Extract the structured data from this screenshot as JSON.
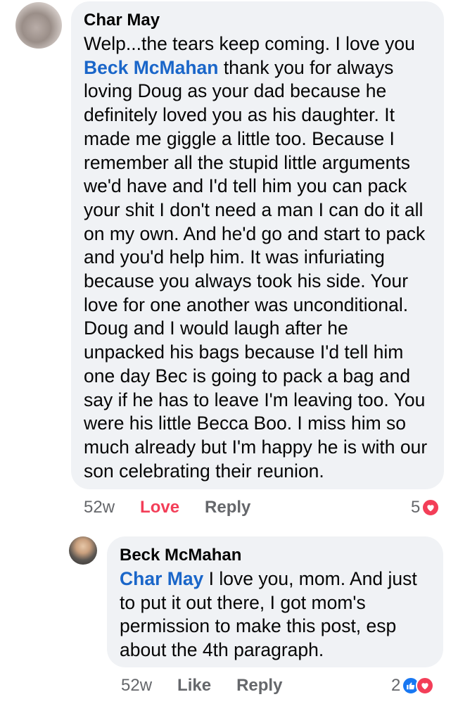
{
  "comments": [
    {
      "author": "Char May",
      "text_parts": [
        "Welp...the tears keep coming. I love you ",
        "Beck McMahan",
        " thank you for always loving Doug as your dad because he definitely loved you as his daughter. It made me giggle a little too. Because I remember all the stupid little arguments we'd have and I'd tell him you can pack your shit I don't need a man I can do it all on my own. And he'd go and start to pack and you'd help him. It was infuriating because you always took his side. Your love for one another was unconditional.  Doug and I would laugh after he unpacked his bags because I'd tell him one day Bec is going to pack a bag and say if he has to leave I'm leaving too. You were his little Becca Boo. I miss him so much already but I'm happy he is with our son celebrating their reunion."
      ],
      "time": "52w",
      "action_react": "Love",
      "action_reply": "Reply",
      "reaction_count": "5",
      "reaction_icons": [
        "heart-icon"
      ],
      "colors": {
        "love": "#f33e58"
      }
    },
    {
      "author": "Beck McMahan",
      "text_parts": [
        "Char May",
        " I love you, mom. And just to put it out there, I got mom's permission to make this post, esp about the 4th paragraph."
      ],
      "time": "52w",
      "action_react": "Like",
      "action_reply": "Reply",
      "reaction_count": "2",
      "reaction_icons": [
        "like-icon",
        "heart-icon"
      ],
      "colors": {
        "like": "#1877f2",
        "love": "#f33e58"
      }
    }
  ]
}
